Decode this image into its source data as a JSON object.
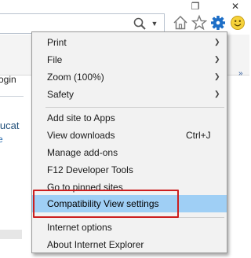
{
  "window": {
    "restore_glyph": "❐",
    "close_glyph": "✕"
  },
  "addressbar": {
    "search_icon": "magnifier-icon",
    "dropdown_glyph": "▼"
  },
  "toolbar": {
    "home_icon": "home-icon",
    "favorites_icon": "star-icon",
    "tools_icon": "gear-icon",
    "feedback_icon": "smiley-icon",
    "accent_color": "#1e6fc7"
  },
  "page": {
    "tab_label": "ogin",
    "more_glyph": "»",
    "snippet_top": "lucat",
    "snippet_bottom": "e"
  },
  "menu": {
    "highlight_color": "#9fcff5",
    "annotation_color": "#cc1f1f",
    "submenus": [
      {
        "label": "Print",
        "arrow": "❯"
      },
      {
        "label": "File",
        "arrow": "❯"
      },
      {
        "label": "Zoom (100%)",
        "arrow": "❯"
      },
      {
        "label": "Safety",
        "arrow": "❯"
      }
    ],
    "items": [
      {
        "label": "Add site to Apps",
        "shortcut": ""
      },
      {
        "label": "View downloads",
        "shortcut": "Ctrl+J"
      },
      {
        "label": "Manage add-ons",
        "shortcut": ""
      },
      {
        "label": "F12 Developer Tools",
        "shortcut": ""
      },
      {
        "label": "Go to pinned sites",
        "shortcut": ""
      },
      {
        "label": "Compatibility View settings",
        "shortcut": ""
      }
    ],
    "footer": [
      {
        "label": "Internet options"
      },
      {
        "label": "About Internet Explorer"
      }
    ]
  }
}
